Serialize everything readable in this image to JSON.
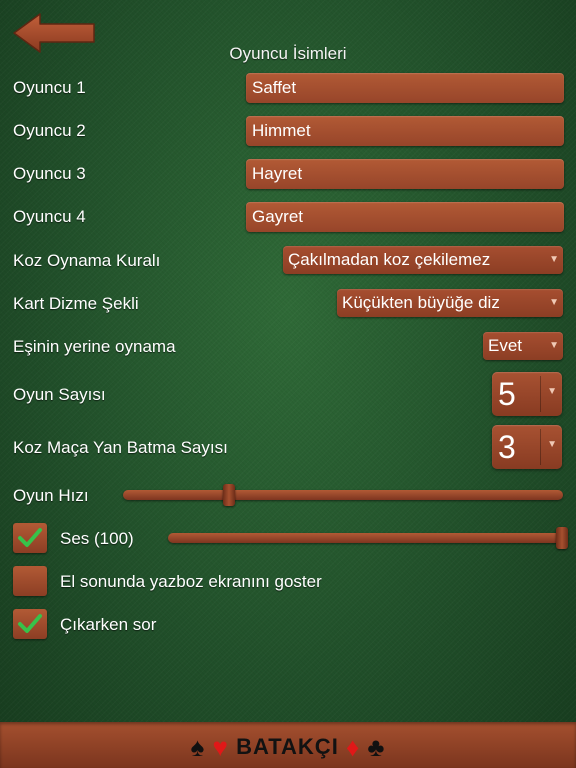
{
  "header": {
    "title": "Oyuncu İsimleri"
  },
  "players": [
    {
      "label": "Oyuncu 1",
      "value": "Saffet"
    },
    {
      "label": "Oyuncu 2",
      "value": "Himmet"
    },
    {
      "label": "Oyuncu 3",
      "value": "Hayret"
    },
    {
      "label": "Oyuncu 4",
      "value": "Gayret"
    }
  ],
  "settings": {
    "trump_rule": {
      "label": "Koz Oynama Kuralı",
      "value": "Çakılmadan koz çekilemez"
    },
    "card_sort": {
      "label": "Kart Dizme Şekli",
      "value": "Küçükten büyüğe diz"
    },
    "partner_play": {
      "label": "Eşinin yerine oynama",
      "value": "Evet"
    },
    "game_count": {
      "label": "Oyun Sayısı",
      "value": "5"
    },
    "spade_count": {
      "label": "Koz Maça Yan Batma Sayısı",
      "value": "3"
    },
    "game_speed": {
      "label": "Oyun Hızı",
      "level": 0.24
    },
    "sound": {
      "label": "Ses (100)",
      "checked": true,
      "level": 1.0
    },
    "show_score": {
      "label": "El sonunda yazboz ekranını goster",
      "checked": false
    },
    "confirm_exit": {
      "label": "Çıkarken sor",
      "checked": true
    }
  },
  "footer": {
    "brand": "BATAKÇI",
    "suit_spade": "♠",
    "suit_heart": "♥",
    "suit_diamond": "♦",
    "suit_club": "♣"
  },
  "colors": {
    "felt": "#21502a",
    "wood": "#a5502f",
    "check": "#37c24a"
  }
}
